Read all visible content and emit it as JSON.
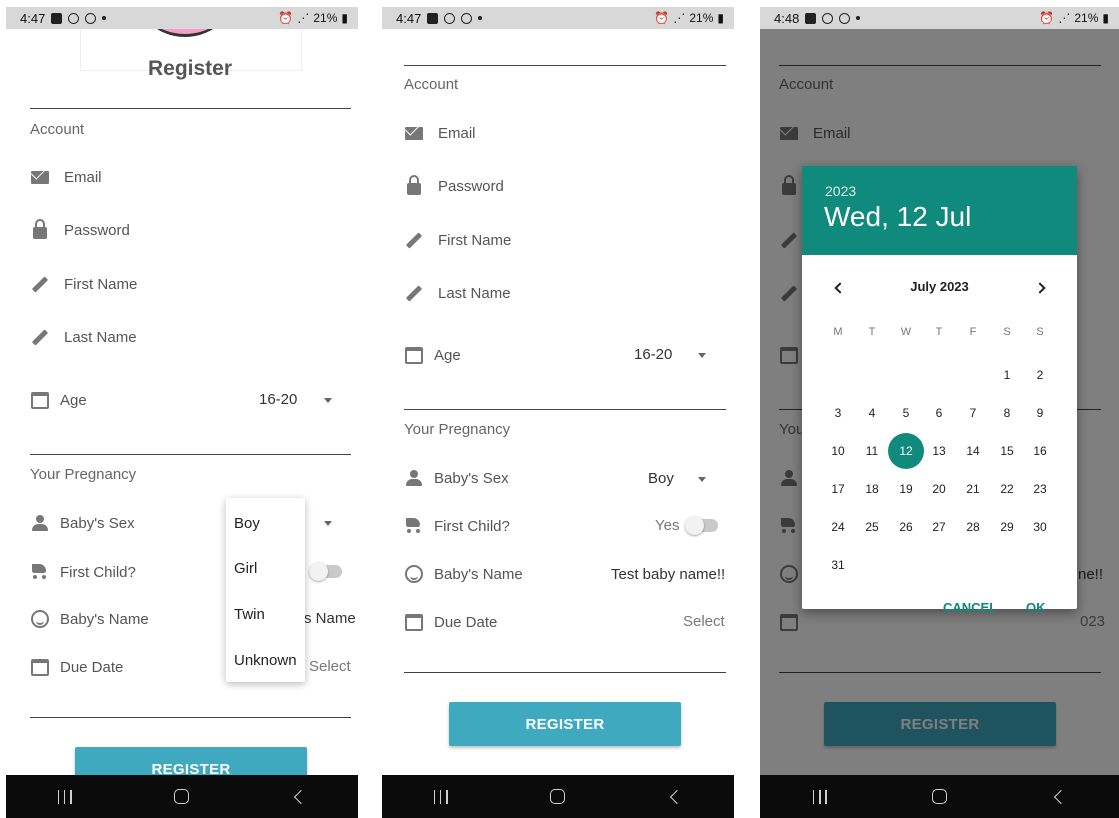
{
  "panel1": {
    "status": {
      "time": "4:47",
      "battery": "21%"
    },
    "title": "Register",
    "account_section": "Account",
    "fields": {
      "email": "Email",
      "password": "Password",
      "first_name": "First Name",
      "last_name": "Last Name",
      "age": "Age"
    },
    "age_value": "16-20",
    "pregnancy_section": "Your Pregnancy",
    "pregnancy_fields": {
      "babys_sex": "Baby's Sex",
      "first_child": "First Child?",
      "babys_name": "Baby's Name",
      "due_date": "Due Date"
    },
    "name_partial": "s Name",
    "due_value": "Select",
    "dropdown_options": [
      "Boy",
      "Girl",
      "Twin",
      "Unknown"
    ],
    "register_button": "REGISTER"
  },
  "panel2": {
    "status": {
      "time": "4:47",
      "battery": "21%"
    },
    "account_section": "Account",
    "fields": {
      "email": "Email",
      "password": "Password",
      "first_name": "First Name",
      "last_name": "Last Name",
      "age": "Age"
    },
    "age_value": "16-20",
    "pregnancy_section": "Your Pregnancy",
    "pregnancy_fields": {
      "babys_sex": "Baby's Sex",
      "first_child": "First Child?",
      "babys_name": "Baby's Name",
      "due_date": "Due Date"
    },
    "sex_value": "Boy",
    "first_child_value": "Yes",
    "name_value": "Test baby name!!",
    "due_value": "Select",
    "register_button": "REGISTER"
  },
  "panel3": {
    "status": {
      "time": "4:48",
      "battery": "21%"
    },
    "account_section": "Account",
    "email_label": "Email",
    "behind_partials": {
      "you": "You",
      "ne": "ne!!",
      "year": "023"
    },
    "register_button": "REGISTER",
    "date_picker": {
      "year": "2023",
      "selected_date": "Wed, 12 Jul",
      "month_label": "July 2023",
      "weekdays": [
        "M",
        "T",
        "W",
        "T",
        "F",
        "S",
        "S"
      ],
      "days": [
        "1",
        "2",
        "3",
        "4",
        "5",
        "6",
        "7",
        "8",
        "9",
        "10",
        "11",
        "12",
        "13",
        "14",
        "15",
        "16",
        "17",
        "18",
        "19",
        "20",
        "21",
        "22",
        "23",
        "24",
        "25",
        "26",
        "27",
        "28",
        "29",
        "30",
        "31"
      ],
      "selected_day": "12",
      "cancel_label": "CANCEL",
      "ok_label": "OK",
      "accent": "#0f8a7c"
    }
  },
  "colors": {
    "register_button": "#3ea9bf",
    "picker_header": "#0f8a7c"
  }
}
